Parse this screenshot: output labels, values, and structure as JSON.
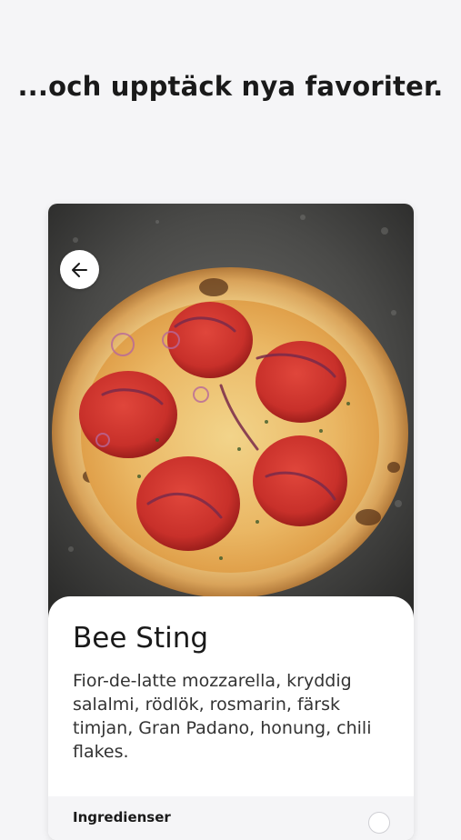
{
  "headline": "...och upptäck nya favoriter.",
  "pizza": {
    "name": "Bee Sting",
    "description": "Fior-de-latte mozzarella, kryddig salalmi, rödlök, rosmarin, färsk timjan, Gran Padano, honung, chili flakes."
  },
  "ingredients_label": "Ingredienser",
  "icons": {
    "back": "arrow-left-icon",
    "expand": "expand-circle-icon"
  },
  "colors": {
    "background": "#f5f5f7",
    "card": "#ffffff",
    "text": "#1a1a1a"
  }
}
